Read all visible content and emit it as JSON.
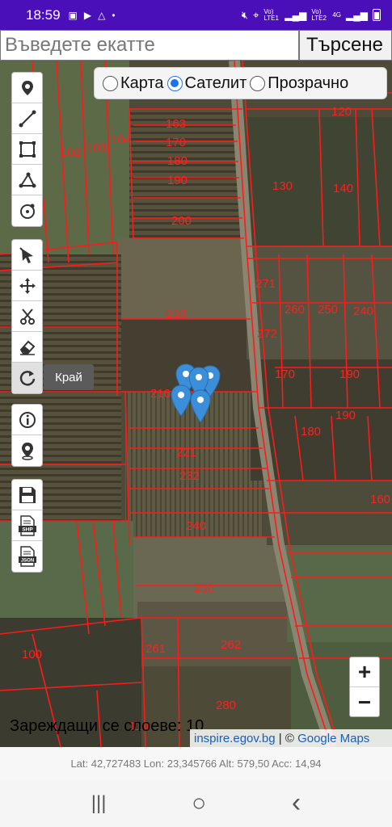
{
  "status": {
    "time": "18:59",
    "net1": "Vo) LTE1",
    "net2": "Vo) LTE2",
    "net3": "4G"
  },
  "search": {
    "placeholder": "Въведете екатте",
    "button_label": "Търсене"
  },
  "layers": {
    "options": [
      "Карта",
      "Сателит",
      "Прозрачно"
    ],
    "selected": "Сателит"
  },
  "tools": {
    "draw": [
      "marker-icon",
      "polyline-icon",
      "rectangle-icon",
      "polygon-icon",
      "circle-marker-icon"
    ],
    "edit": [
      "edit-pointer-icon",
      "move-icon",
      "cut-icon",
      "eraser-icon",
      "rotate-icon"
    ],
    "info": [
      "info-icon",
      "location-pin-icon"
    ],
    "export": [
      "save-icon",
      "shp-export-icon",
      "json-export-icon"
    ],
    "tooltip": "Край"
  },
  "parcels": [
    {
      "label": "163"
    },
    {
      "label": "170"
    },
    {
      "label": "180"
    },
    {
      "label": "190"
    },
    {
      "label": "200"
    },
    {
      "label": "104"
    },
    {
      "label": "103"
    },
    {
      "label": "102"
    },
    {
      "label": "210"
    },
    {
      "label": "216"
    },
    {
      "label": "221"
    },
    {
      "label": "232"
    },
    {
      "label": "240"
    },
    {
      "label": "250"
    },
    {
      "label": "261"
    },
    {
      "label": "262"
    },
    {
      "label": "280"
    },
    {
      "label": "130"
    },
    {
      "label": "140"
    },
    {
      "label": "120"
    },
    {
      "label": "271"
    },
    {
      "label": "272"
    },
    {
      "label": "260"
    },
    {
      "label": "250"
    },
    {
      "label": "240"
    },
    {
      "label": "170"
    },
    {
      "label": "180"
    },
    {
      "label": "190"
    },
    {
      "label": "160"
    },
    {
      "label": "100"
    },
    {
      "label": "110"
    },
    {
      "label": "190"
    }
  ],
  "zoom": {
    "in": "+",
    "out": "−"
  },
  "loading_text": "Зареждащи се слоеве: 10",
  "attribution": {
    "source": "inspire.egov.bg",
    "sep": " | © ",
    "maps": "Google Maps"
  },
  "coords": "Lat: 42,727483 Lon: 23,345766 Alt: 579,50 Acc: 14,94",
  "nav": {
    "recents": "|||",
    "home": "○",
    "back": "‹"
  }
}
